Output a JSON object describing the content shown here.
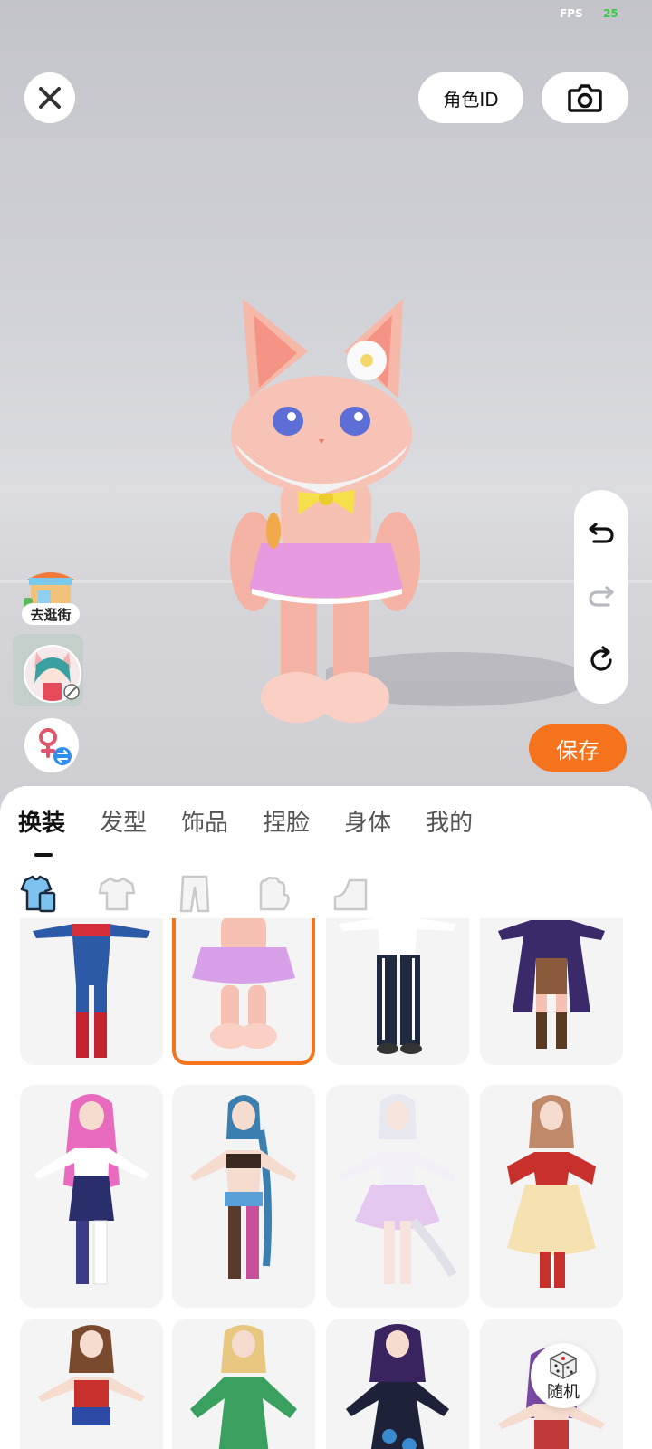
{
  "status": {
    "fps_label": "FPS",
    "fps_value": "25"
  },
  "top_bar": {
    "role_id_label": "角色ID"
  },
  "left_actions": {
    "shop_label": "去逛街"
  },
  "save_label": "保存",
  "tabs": [
    {
      "label": "换装",
      "active": true
    },
    {
      "label": "发型",
      "active": false
    },
    {
      "label": "饰品",
      "active": false
    },
    {
      "label": "捏脸",
      "active": false
    },
    {
      "label": "身体",
      "active": false
    },
    {
      "label": "我的",
      "active": false
    }
  ],
  "subtabs": [
    "outfit-set-icon",
    "top-icon",
    "pants-icon",
    "gloves-icon",
    "shoes-icon"
  ],
  "outfit_items_selected_index": 1,
  "random_label": "随机",
  "colors": {
    "accent": "#f5731c",
    "panel": "#ffffff",
    "card": "#f4f4f5"
  }
}
